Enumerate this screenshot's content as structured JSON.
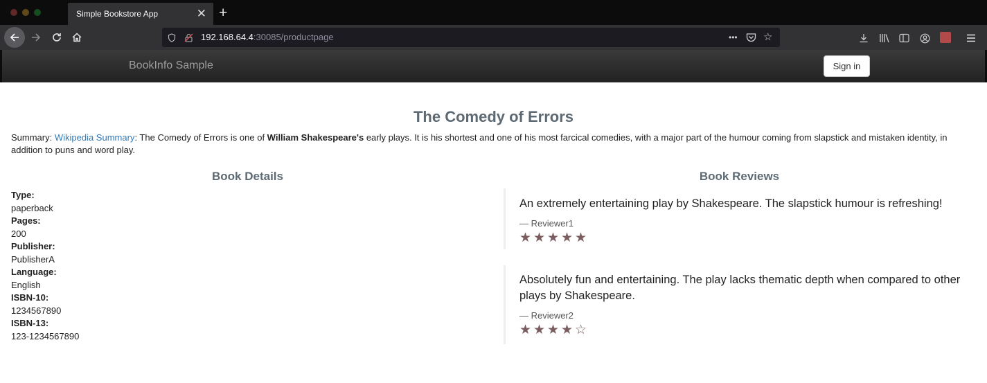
{
  "browser": {
    "tab_title": "Simple Bookstore App",
    "tab_close": "✕",
    "new_tab": "+",
    "url_host": "192.168.64.4",
    "url_path": ":30085/productpage",
    "url_menu": "•••"
  },
  "header": {
    "brand": "BookInfo Sample",
    "signin_label": "Sign in"
  },
  "book": {
    "title": "The Comedy of Errors",
    "summary_label": "Summary: ",
    "summary_link": "Wikipedia Summary",
    "summary_pre": ": The Comedy of Errors is one of ",
    "summary_author": "William Shakespeare's",
    "summary_post": " early plays. It is his shortest and one of his most farcical comedies, with a major part of the humour coming from slapstick and mistaken identity, in addition to puns and word play."
  },
  "details": {
    "heading": "Book Details",
    "type_label": "Type:",
    "type": "paperback",
    "pages_label": "Pages:",
    "pages": "200",
    "publisher_label": "Publisher:",
    "publisher": "PublisherA",
    "language_label": "Language:",
    "language": "English",
    "isbn10_label": "ISBN-10:",
    "isbn10": "1234567890",
    "isbn13_label": "ISBN-13:",
    "isbn13": "123-1234567890"
  },
  "reviews": {
    "heading": "Book Reviews",
    "items": [
      {
        "text": "An extremely entertaining play by Shakespeare. The slapstick humour is refreshing!",
        "reviewer": "— Reviewer1",
        "rating": 5
      },
      {
        "text": "Absolutely fun and entertaining. The play lacks thematic depth when compared to other plays by Shakespeare.",
        "reviewer": "— Reviewer2",
        "rating": 4
      }
    ],
    "max_rating": 5,
    "star_color": "#7c5d5f"
  }
}
